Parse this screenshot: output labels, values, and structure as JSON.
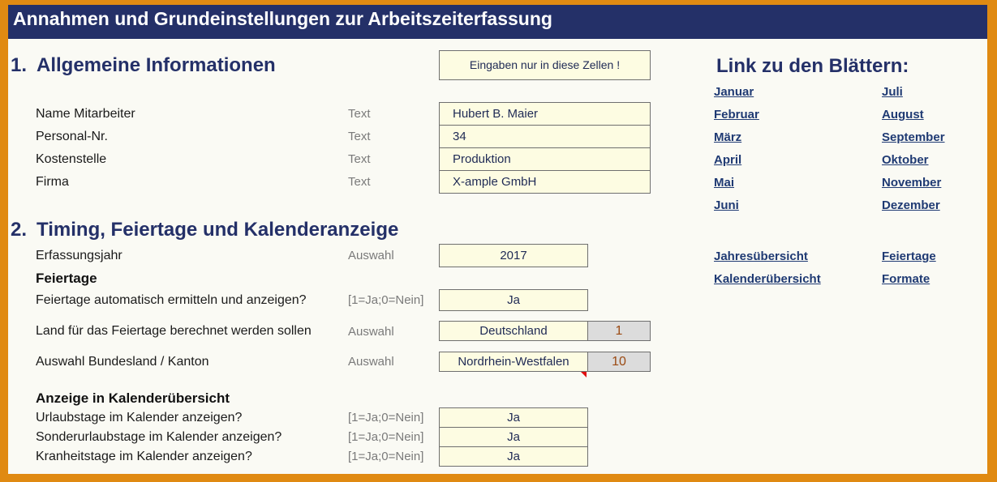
{
  "title": "Annahmen und Grundeinstellungen zur Arbeitszeiterfassung",
  "section1": {
    "number": "1.",
    "heading": "Allgemeine Informationen",
    "note": "Eingaben nur in diese Zellen !",
    "rows": [
      {
        "label": "Name Mitarbeiter",
        "hint": "Text",
        "value": "Hubert B. Maier"
      },
      {
        "label": "Personal-Nr.",
        "hint": "Text",
        "value": "34"
      },
      {
        "label": "Kostenstelle",
        "hint": "Text",
        "value": "Produktion"
      },
      {
        "label": "Firma",
        "hint": "Text",
        "value": "X-ample GmbH"
      }
    ]
  },
  "section2": {
    "number": "2.",
    "heading": "Timing, Feiertage und Kalenderanzeige",
    "year": {
      "label": "Erfassungsjahr",
      "hint": "Auswahl",
      "value": "2017"
    },
    "holidays_heading": "Feiertage",
    "auto_holidays": {
      "label": "Feiertage automatisch ermitteln und anzeigen?",
      "hint": "[1=Ja;0=Nein]",
      "value": "Ja"
    },
    "country": {
      "label": "Land für das Feiertage berechnet werden sollen",
      "hint": "Auswahl",
      "value": "Deutschland",
      "code": "1"
    },
    "state": {
      "label": "Auswahl Bundesland / Kanton",
      "hint": "Auswahl",
      "value": "Nordrhein-Westfalen",
      "code": "10"
    },
    "calendar_heading": "Anzeige in Kalenderübersicht",
    "calendar_rows": [
      {
        "label": "Urlaubstage im Kalender anzeigen?",
        "hint": "[1=Ja;0=Nein]",
        "value": "Ja"
      },
      {
        "label": "Sonderurlaubstage im Kalender anzeigen?",
        "hint": "[1=Ja;0=Nein]",
        "value": "Ja"
      },
      {
        "label": "Kranheitstage im Kalender anzeigen?",
        "hint": "[1=Ja;0=Nein]",
        "value": "Ja"
      }
    ]
  },
  "links": {
    "heading": "Link zu den Blättern:",
    "months_left": [
      "Januar",
      "Februar",
      "März",
      "April",
      "Mai",
      "Juni"
    ],
    "months_right": [
      "Juli",
      "August",
      "September",
      "Oktober",
      "November",
      "Dezember"
    ],
    "extra_left": [
      "Jahresübersicht",
      "Kalenderübersicht"
    ],
    "extra_right": [
      "Feiertage",
      "Formate"
    ]
  },
  "colors": {
    "header_bg": "#243068",
    "input_bg": "#fdfce2",
    "frame": "#e08a12",
    "link": "#1f3a73"
  }
}
